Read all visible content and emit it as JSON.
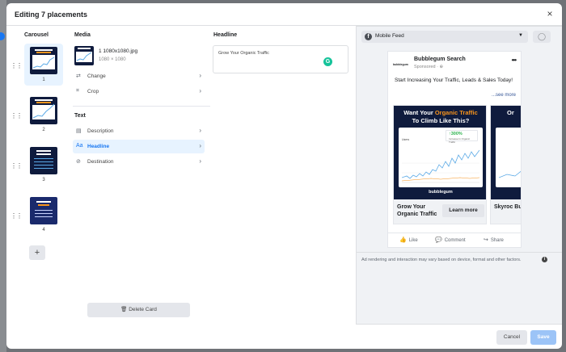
{
  "modal": {
    "title": "Editing 7 placements",
    "close_icon": "×"
  },
  "carousel": {
    "title": "Carousel",
    "cards": [
      {
        "number": "1",
        "active": true
      },
      {
        "number": "2",
        "active": false
      },
      {
        "number": "3",
        "active": false
      },
      {
        "number": "4",
        "active": false
      }
    ],
    "add_label": "+"
  },
  "media": {
    "title": "Media",
    "filename": "1 1080x1080.jpg",
    "dimensions": "1080 × 1080",
    "change_label": "Change",
    "crop_label": "Crop"
  },
  "text": {
    "title": "Text",
    "description_label": "Description",
    "headline_label": "Headline",
    "destination_label": "Destination"
  },
  "delete_label": "Delete Card",
  "headline": {
    "title": "Headline",
    "value": "Grow Your Organic Traffic"
  },
  "preview": {
    "feed_label": "Mobile Feed",
    "ad": {
      "page_name": "Bubblegum Search",
      "avatar_text": "bubblegum",
      "sponsored": "Sponsored · ⊕",
      "primary_text": "Start Increasing Your Traffic, Leads & Sales Today!",
      "see_more": "...see more",
      "slide1": {
        "headline_white_1": "Want Your ",
        "headline_orange": "Organic Traffic",
        "headline_white_2": "To Climb Like This?",
        "pct": "↑300%",
        "pct_sub": "Increase In Organic Traffic",
        "users": "Users",
        "brand": "bubblegum",
        "title": "Grow Your Organic Traffic",
        "cta": "Learn more"
      },
      "slide2": {
        "headline": "Or",
        "title": "Skyroc Busine"
      },
      "actions": {
        "like": "Like",
        "comment": "Comment",
        "share": "Share"
      }
    },
    "disclaimer": "Ad rendering and interaction may vary based on device, format and other factors."
  },
  "footer": {
    "cancel": "Cancel",
    "save": "Save"
  },
  "colors": {
    "accent": "#1877f2",
    "save_disabled": "#9cc4f7",
    "slide_bg": "#0f1b3d",
    "orange": "#f7941d",
    "growth_green": "#2bb24c"
  }
}
